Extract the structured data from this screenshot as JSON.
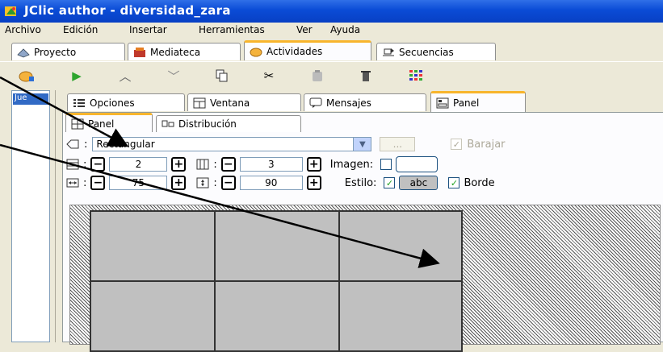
{
  "window": {
    "title": "JClic author - diversidad_zara"
  },
  "menubar": {
    "items": [
      "Archivo",
      "Edición",
      "Insertar",
      "Herramientas",
      "Ver",
      "Ayuda"
    ]
  },
  "main_tabs": [
    {
      "label": "Proyecto",
      "icon": "project-icon"
    },
    {
      "label": "Mediateca",
      "icon": "media-library-icon"
    },
    {
      "label": "Actividades",
      "icon": "activities-icon",
      "active": true
    },
    {
      "label": "Secuencias",
      "icon": "sequences-icon"
    }
  ],
  "toolbar": {
    "buttons": [
      "new-activity-icon",
      "play-icon",
      "move-up-icon",
      "move-down-icon",
      "copy-icon",
      "cut-icon",
      "paste-icon",
      "delete-icon",
      "grid-icon"
    ]
  },
  "activity_list": {
    "selected": "Jue"
  },
  "sub_tabs": [
    {
      "label": "Opciones",
      "icon": "options-icon"
    },
    {
      "label": "Ventana",
      "icon": "window-icon"
    },
    {
      "label": "Mensajes",
      "icon": "messages-icon"
    },
    {
      "label": "Panel",
      "icon": "panel-icon",
      "active": true
    }
  ],
  "panel_tabs": [
    {
      "label": "Panel",
      "icon": "panel-grid-icon",
      "active": true
    },
    {
      "label": "Distribución",
      "icon": "distribution-icon"
    }
  ],
  "panel": {
    "shape_select": {
      "value": "Rectangular"
    },
    "more_button": "...",
    "shuffle": {
      "label": "Barajar",
      "checked": true,
      "enabled": false
    },
    "rows": {
      "value": "2"
    },
    "cols": {
      "value": "3"
    },
    "image_label": "Imagen:",
    "width": {
      "value": "75"
    },
    "height": {
      "value": "90"
    },
    "style_label": "Estilo:",
    "style_sample": "abc",
    "border": {
      "label": "Borde",
      "checked": true
    },
    "minus": "−",
    "plus": "+"
  },
  "grid_preview": {
    "rows": 2,
    "cols": 3,
    "fill": "#c0c0c0"
  }
}
